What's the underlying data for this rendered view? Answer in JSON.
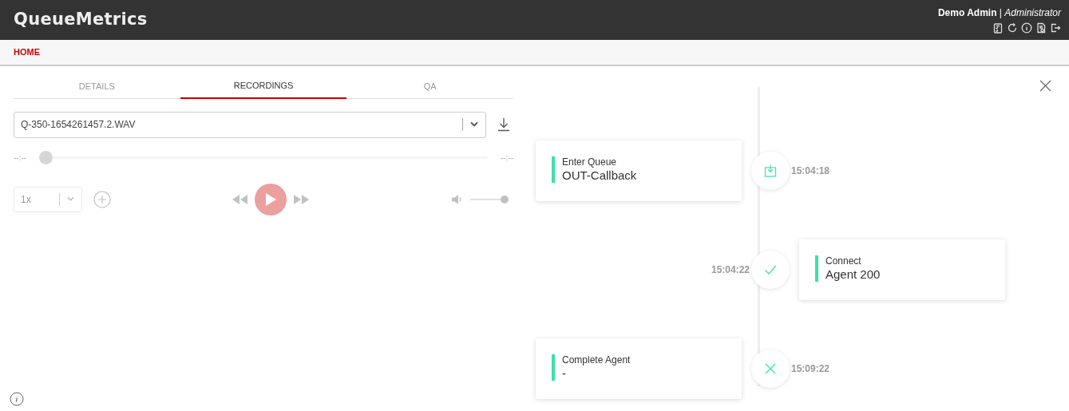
{
  "header": {
    "logo": "QueueMetrics",
    "user": "Demo Admin",
    "separator": "|",
    "role": "Administrator"
  },
  "nav": [
    {
      "label": "HOME",
      "selected": true
    }
  ],
  "tabs": [
    {
      "label": "DETAILS",
      "selected": false
    },
    {
      "label": "RECORDINGS",
      "selected": true
    },
    {
      "label": "QA",
      "selected": false
    }
  ],
  "player": {
    "file": "Q-350-1654261457.2.WAV",
    "disabled": true,
    "elapsed": "--:--",
    "duration": "--:--",
    "seek": {
      "level": 0
    },
    "speed": "1x",
    "volume": {
      "level": 1
    }
  },
  "timeline": [
    {
      "kind": "enter",
      "label": "Enter Queue",
      "value": "OUT-Callback",
      "time": "15:04:18"
    },
    {
      "kind": "connect",
      "label": "Connect",
      "value": "Agent 200",
      "time": "15:04:22"
    },
    {
      "kind": "complete",
      "label": "Complete Agent",
      "value": "-",
      "time": "15:09:22"
    }
  ]
}
